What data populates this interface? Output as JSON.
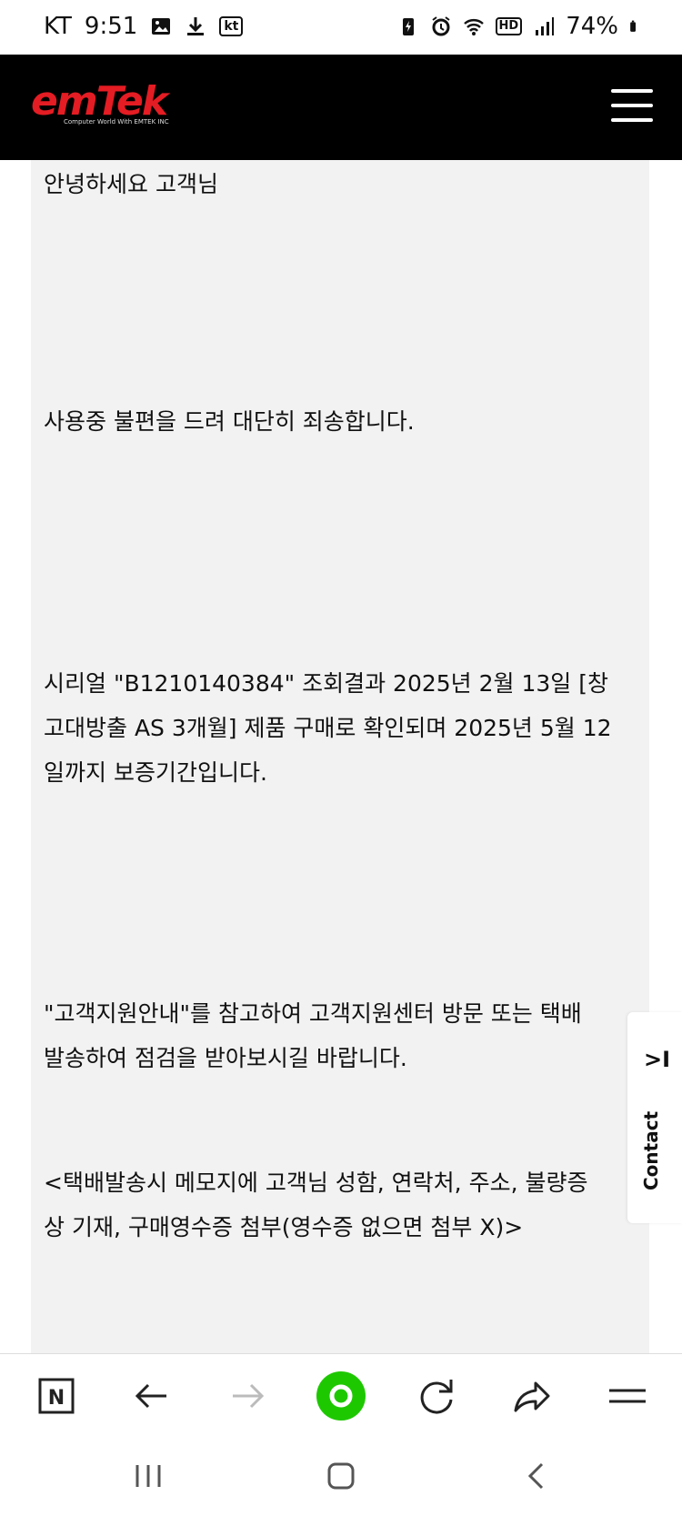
{
  "status_bar": {
    "carrier": "KT",
    "time": "9:51",
    "carrier_badge": "kt",
    "hd_badge": "HD",
    "battery": "74%"
  },
  "header": {
    "logo_text": "emTek",
    "logo_subtext": "Computer World With EMTEK INC",
    "brand_color": "#e41c23"
  },
  "content": {
    "greeting": "안녕하세요  고객님",
    "apology": "사용중 불편을 드려 대단히 죄송합니다.",
    "serial_line1": "시리얼 \"B1210140384\" 조회결과 2025년 2월 13일 [창",
    "serial_line2": "고대방출 AS 3개월] 제품 구매로 확인되며 2025년 5월 12",
    "serial_line3": "일까지 보증기간입니다.",
    "guide_line1": "\"고객지원안내\"를 참고하여 고객지원센터 방문 또는 택배",
    "guide_line2": "발송하여 점검을 받아보시길 바랍니다.",
    "note_line1": "<택배발송시 메모지에 고객님 성함, 연락처, 주소, 불량증",
    "note_line2": "상 기재, 구매영수증 첨부(영수증 없으면 첨부 X)>"
  },
  "contact_tab": {
    "label": "Contact",
    "arrow": ">I"
  },
  "toolbar": {
    "home_icon_letter": "N",
    "accent_color": "#1ec800"
  }
}
